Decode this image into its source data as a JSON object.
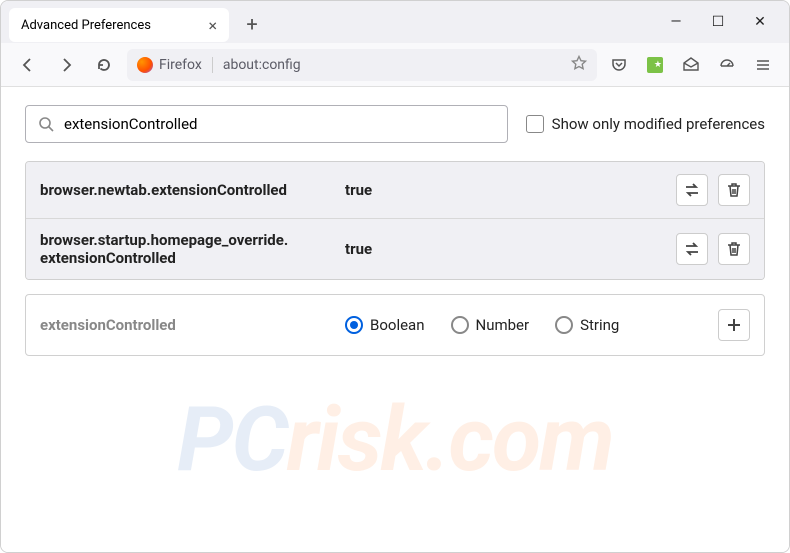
{
  "tab": {
    "title": "Advanced Preferences"
  },
  "addr": {
    "label": "Firefox",
    "url": "about:config"
  },
  "search": {
    "value": "extensionControlled"
  },
  "checkbox": {
    "label": "Show only modified preferences"
  },
  "prefs": [
    {
      "name": "browser.newtab.extensionControlled",
      "value": "true"
    },
    {
      "name": "browser.startup.homepage_override.\nextensionControlled",
      "value": "true"
    }
  ],
  "newpref": {
    "name": "extensionControlled",
    "options": [
      "Boolean",
      "Number",
      "String"
    ],
    "selected": 0
  },
  "watermark": {
    "pc": "PC",
    "rest": "risk.com"
  }
}
